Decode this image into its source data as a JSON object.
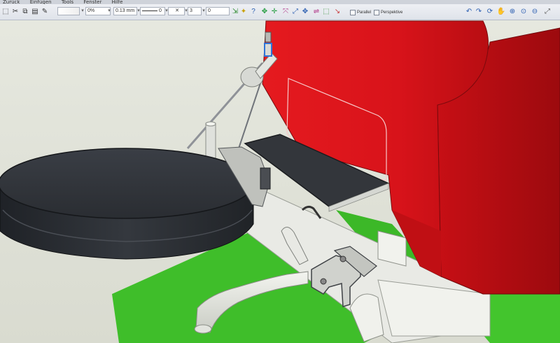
{
  "menubar": {
    "items": [
      "Zurück",
      "Einfügen",
      "Tools",
      "Fenster",
      "Hilfe"
    ]
  },
  "toolbar": {
    "opacity": "0%",
    "line_width": "0.13 mm",
    "line_count": "0",
    "spacing": "3",
    "offset": "0",
    "parallel_label": "Parallel",
    "perspective_label": "Perspektive"
  },
  "scene": {
    "colors": {
      "housing": "#e8141a",
      "tire": "#2b2e33",
      "floor": "#3fbe2a",
      "frame": "#e9eae5",
      "background": "#e3e5dc"
    }
  }
}
